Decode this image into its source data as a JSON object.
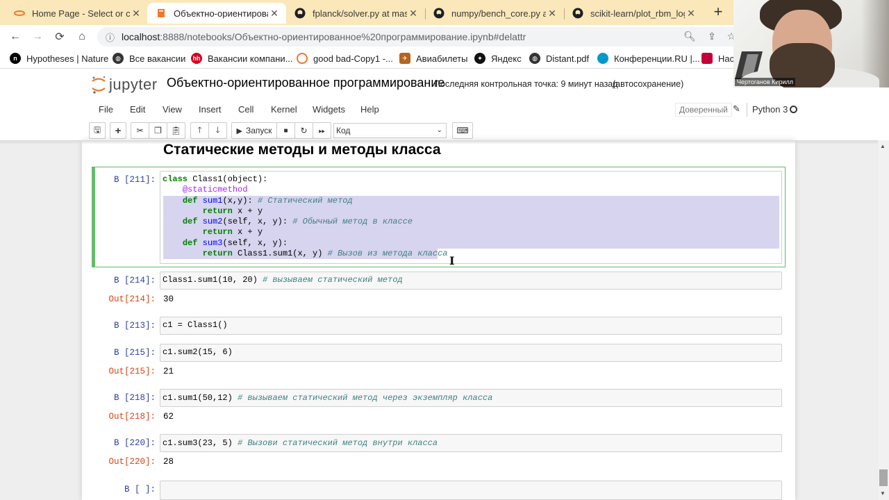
{
  "browser": {
    "tabs": [
      {
        "title": "Home Page - Select or cre",
        "icon": "jupyter-icon",
        "active": false
      },
      {
        "title": "Объектно-ориентирован",
        "icon": "notebook-icon",
        "active": true
      },
      {
        "title": "fplanck/solver.py at mast",
        "icon": "github-icon",
        "active": false
      },
      {
        "title": "numpy/bench_core.py at",
        "icon": "github-icon",
        "active": false
      },
      {
        "title": "scikit-learn/plot_rbm_log",
        "icon": "github-icon",
        "active": false
      }
    ],
    "url_host": "localhost",
    "url_rest": ":8888/notebooks/Объектно-ориентированное%20программирование.ipynb#delattr",
    "bookmarks": [
      {
        "label": "Hypotheses | Nature",
        "color": "#000000",
        "glyph": "n"
      },
      {
        "label": "Все вакансии",
        "color": "#333333",
        "glyph": ""
      },
      {
        "label": "Вакансии компани...",
        "color": "#d6001c",
        "glyph": "hh"
      },
      {
        "label": "good bad-Copy1 -...",
        "color": "#f37626",
        "glyph": ""
      },
      {
        "label": "Авиабилеты",
        "color": "#b5651d",
        "glyph": ""
      },
      {
        "label": "Яндекс",
        "color": "#111111",
        "glyph": ""
      },
      {
        "label": "Distant.pdf",
        "color": "#333333",
        "glyph": ""
      },
      {
        "label": "Конференции.RU |...",
        "color": "#0099cc",
        "glyph": ""
      },
      {
        "label": "Нас",
        "color": "#c4003a",
        "glyph": ""
      }
    ]
  },
  "jupyter": {
    "logo_text": "jupyter",
    "notebook_name": "Объектно-ориентированное программирование",
    "checkpoint": "Последняя контрольная точка: 9 минут назад",
    "autosave": "(автосохранение)",
    "menu": [
      "File",
      "Edit",
      "View",
      "Insert",
      "Cell",
      "Kernel",
      "Widgets",
      "Help"
    ],
    "trusted": "Доверенный",
    "kernel": "Python 3",
    "run_label": "Запуск",
    "cell_type": "Код"
  },
  "notebook": {
    "heading": "Статические методы и методы класса",
    "cells": [
      {
        "in": "В [211]:",
        "out": "",
        "result": ""
      },
      {
        "in": "В [214]:",
        "out": "Out[214]:",
        "result": "30"
      },
      {
        "in": "В [213]:",
        "out": "",
        "result": ""
      },
      {
        "in": "В [215]:",
        "out": "Out[215]:",
        "result": "21"
      },
      {
        "in": "В [218]:",
        "out": "Out[218]:",
        "result": "62"
      },
      {
        "in": "В [220]:",
        "out": "Out[220]:",
        "result": "28"
      },
      {
        "in": "В [ ]:",
        "out": "",
        "result": ""
      }
    ],
    "code": {
      "c211_l1": "class",
      "c211_l1b": " Class1(object):",
      "c211_l2": "@staticmethod",
      "c211_l3_def": "def",
      "c211_l3_fn": "sum1",
      "c211_l3_args": "(x,y): ",
      "c211_l3_cm": "# Статический метод",
      "c211_l4_ret": "return",
      "c211_l4_rest": " x + y",
      "c211_l5_def": "def",
      "c211_l5_fn": "sum2",
      "c211_l5_args": "(self, x, y): ",
      "c211_l5_cm": "# Обычный метод в классе",
      "c211_l6_ret": "return",
      "c211_l6_rest": " x + y",
      "c211_l7_def": "def",
      "c211_l7_fn": "sum3",
      "c211_l7_args": "(self, x, y):",
      "c211_l8_ret": "return",
      "c211_l8_rest": " Class1.sum1(x, y) ",
      "c211_l8_cm": "# Вызов из метода класса",
      "c214_code": "Class1.sum1(10, 20) ",
      "c214_cm": "# вызываем статический метод",
      "c213_code": "c1 = Class1()",
      "c215_code": "c1.sum2(15, 6)",
      "c218_code": "c1.sum1(50,12) ",
      "c218_cm": "# вызываем статический метод через экземпляр класса",
      "c220_code": "c1.sum3(23, 5) ",
      "c220_cm": "# Вызови статический метод внутри класса"
    }
  },
  "webcam": {
    "name_label": "Чертоганов Кирилл"
  },
  "colors": {
    "tabstrip": "#fae7ba",
    "selected_cell_border": "#66bb6a",
    "prompt_in": "#303f9f",
    "prompt_out": "#d84315",
    "selection": "#d7d4f0"
  }
}
